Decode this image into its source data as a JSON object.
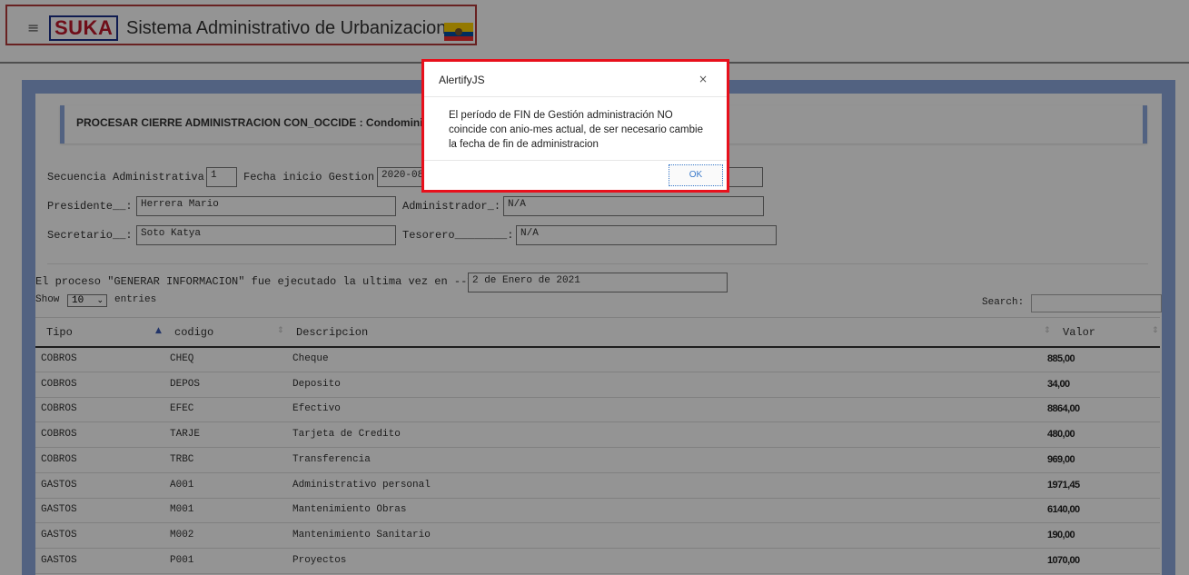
{
  "header": {
    "menu_icon": "hamburger-menu-icon",
    "logo_text": "SUKA",
    "title": "Sistema Administrativo de Urbanizaciones",
    "flag_icon": "ecuador-flag-icon"
  },
  "section": {
    "title": "PROCESAR CIERRE ADMINISTRACION CON_OCCIDE : Condominios AB"
  },
  "form": {
    "secuencia_label": "Secuencia Administrativa",
    "secuencia_value": "1",
    "fecha_inicio_label": "Fecha inicio Gestion",
    "fecha_inicio_value": "2020-08",
    "presidente_label": "Presidente__:",
    "presidente_value": "Herrera Mario",
    "administrador_label": "Administrador_:",
    "administrador_value": "N/A",
    "secretario_label": "Secretario__:",
    "secretario_value": "Soto  Katya",
    "tesorero_label": "Tesorero________:",
    "tesorero_value": "N/A"
  },
  "process": {
    "label": "El proceso \"GENERAR INFORMACION\" fue ejecutado la ultima vez en -->",
    "value": "2 de Enero de 2021"
  },
  "table_controls": {
    "show_label": "Show",
    "entries_value": "10",
    "entries_label": "entries",
    "search_label": "Search:"
  },
  "table": {
    "columns": [
      "Tipo",
      "codigo",
      "Descripcion",
      "Valor"
    ],
    "rows": [
      {
        "tipo": "COBROS",
        "codigo": "CHEQ",
        "descripcion": "Cheque",
        "valor": "885,00"
      },
      {
        "tipo": "COBROS",
        "codigo": "DEPOS",
        "descripcion": "Deposito",
        "valor": "34,00"
      },
      {
        "tipo": "COBROS",
        "codigo": "EFEC",
        "descripcion": "Efectivo",
        "valor": "8864,00"
      },
      {
        "tipo": "COBROS",
        "codigo": "TARJE",
        "descripcion": "Tarjeta de Credito",
        "valor": "480,00"
      },
      {
        "tipo": "COBROS",
        "codigo": "TRBC",
        "descripcion": "Transferencia",
        "valor": "969,00"
      },
      {
        "tipo": "GASTOS",
        "codigo": "A001",
        "descripcion": "Administrativo personal",
        "valor": "1971,45"
      },
      {
        "tipo": "GASTOS",
        "codigo": "M001",
        "descripcion": "Mantenimiento Obras",
        "valor": "6140,00"
      },
      {
        "tipo": "GASTOS",
        "codigo": "M002",
        "descripcion": "Mantenimiento Sanitario",
        "valor": "190,00"
      },
      {
        "tipo": "GASTOS",
        "codigo": "P001",
        "descripcion": "Proyectos",
        "valor": "1070,00"
      }
    ]
  },
  "dialog": {
    "title": "AlertifyJS",
    "close_label": "×",
    "message": "El período de FIN de Gestión administración NO coincide con anio-mes actual, de ser necesario cambie la fecha de fin de administracion",
    "ok_label": "OK",
    "highlight_color": "#e8101c"
  },
  "colors": {
    "accent_blue": "#8eaadf",
    "logo_red": "#c0192b",
    "logo_navy": "#1a2f8a"
  }
}
